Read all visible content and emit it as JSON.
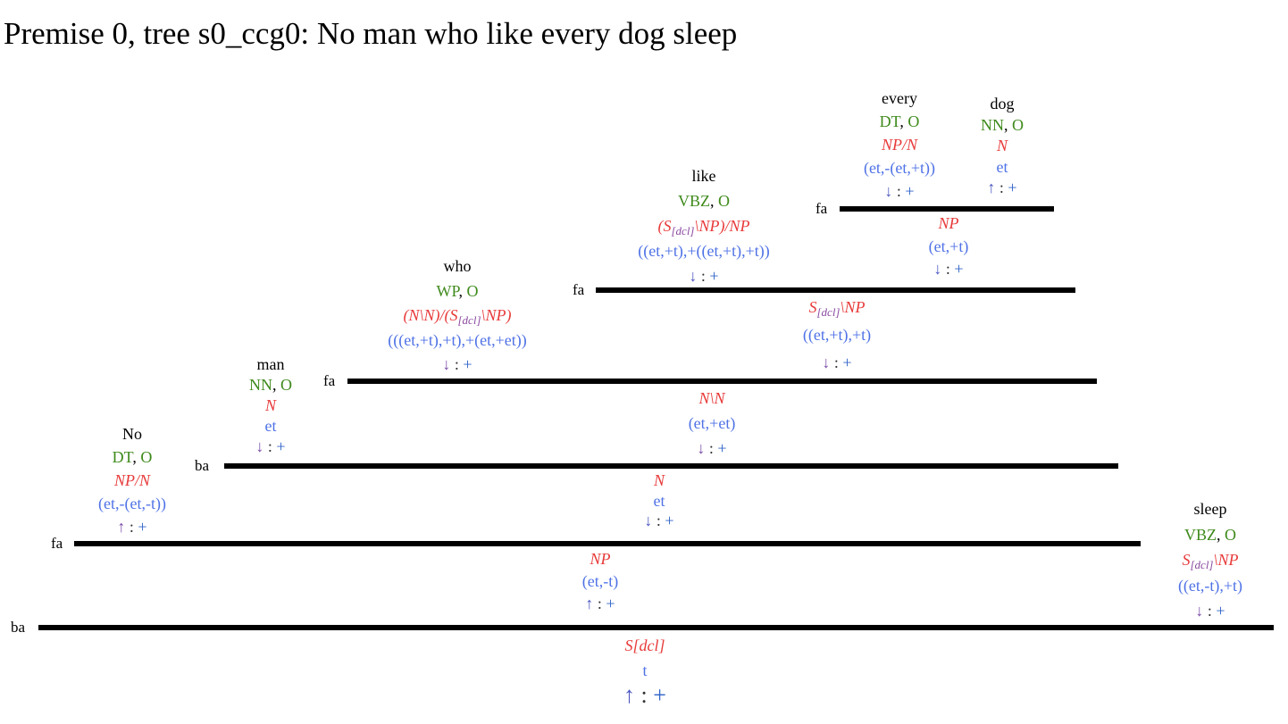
{
  "title": "Premise 0, tree s0_ccg0: No man who like every dog sleep",
  "colors": {
    "word": "#000000",
    "pos": "#3f8a1c",
    "category": "#e83a3a",
    "subscript": "#8a4aa0",
    "type": "#4f72e6",
    "polarity_arrow": "#4a55c0",
    "polarity_sign": "#2f63c8",
    "bar": "#000000"
  },
  "leaves": {
    "every": {
      "word": "every",
      "pos": "DT",
      "ner": "O",
      "cat": "NP/N",
      "type": "(et,-(et,+t))",
      "arrow": "↓",
      "sign": "+"
    },
    "dog": {
      "word": "dog",
      "pos": "NN",
      "ner": "O",
      "cat": "N",
      "type": "et",
      "arrow": "↑",
      "sign": "+"
    },
    "like": {
      "word": "like",
      "pos": "VBZ",
      "ner": "O",
      "cat": "(S[dcl]\\NP)/NP",
      "type": "((et,+t),+((et,+t),+t))",
      "arrow": "↓",
      "sign": "+"
    },
    "who": {
      "word": "who",
      "pos": "WP",
      "ner": "O",
      "cat": "(N\\N)/(S[dcl]\\NP)",
      "type": "(((et,+t),+t),+(et,+et))",
      "arrow": "↓",
      "sign": "+"
    },
    "man": {
      "word": "man",
      "pos": "NN",
      "ner": "O",
      "cat": "N",
      "type": "et",
      "arrow": "↓",
      "sign": "+"
    },
    "no": {
      "word": "No",
      "pos": "DT",
      "ner": "O",
      "cat": "NP/N",
      "type": "(et,-(et,-t))",
      "arrow": "↑",
      "sign": "+"
    },
    "sleep": {
      "word": "sleep",
      "pos": "VBZ",
      "ner": "O",
      "cat": "S[dcl]\\NP",
      "type": "((et,-t),+t)",
      "arrow": "↓",
      "sign": "+"
    }
  },
  "rules": {
    "every_dog": {
      "rule": "fa",
      "cat": "NP",
      "type": "(et,+t)",
      "arrow": "↓",
      "sign": "+"
    },
    "like_np": {
      "rule": "fa",
      "cat": "S[dcl]\\NP",
      "type": "((et,+t),+t)",
      "arrow": "↓",
      "sign": "+"
    },
    "who_vp": {
      "rule": "fa",
      "cat": "N\\N",
      "type": "(et,+et)",
      "arrow": "↓",
      "sign": "+"
    },
    "man_rel": {
      "rule": "ba",
      "cat": "N",
      "type": "et",
      "arrow": "↓",
      "sign": "+"
    },
    "no_n": {
      "rule": "fa",
      "cat": "NP",
      "type": "(et,-t)",
      "arrow": "↑",
      "sign": "+"
    },
    "root": {
      "rule": "ba",
      "cat": "S[dcl]",
      "type": "t",
      "arrow": "↑",
      "sign": "+"
    }
  }
}
